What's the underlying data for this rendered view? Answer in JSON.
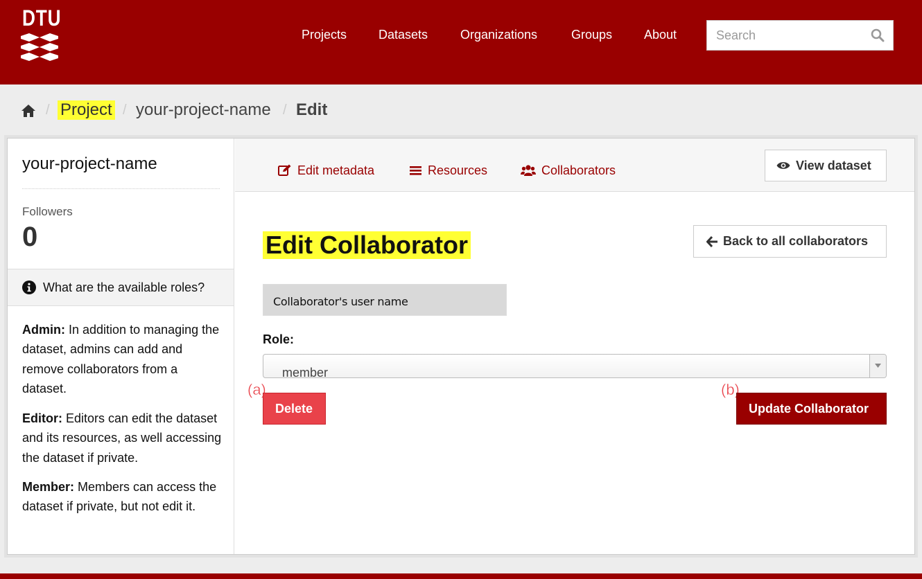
{
  "brand": {
    "logo_text": "DTU"
  },
  "nav": {
    "items": [
      {
        "label": "Projects"
      },
      {
        "label": "Datasets"
      },
      {
        "label": "Organizations"
      },
      {
        "label": "Groups"
      },
      {
        "label": "About"
      }
    ],
    "search_placeholder": "Search"
  },
  "breadcrumb": {
    "home_icon": "home-icon",
    "items": [
      "Project",
      "your-project-name",
      "Edit"
    ],
    "separator": "/"
  },
  "sidebar": {
    "title": "your-project-name",
    "followers_label": "Followers",
    "followers_count": "0",
    "roles_header": "What are the available roles?",
    "roles": [
      {
        "name": "Admin:",
        "text": " In addition to managing the dataset, admins can add and remove collaborators from a dataset."
      },
      {
        "name": "Editor:",
        "text": " Editors can edit the dataset and its resources, as well accessing the dataset if private."
      },
      {
        "name": "Member:",
        "text": " Members can access the dataset if private, but not edit it."
      }
    ]
  },
  "tabs": [
    {
      "label": "Edit metadata",
      "icon": "edit-icon"
    },
    {
      "label": "Resources",
      "icon": "list-icon"
    },
    {
      "label": "Collaborators",
      "icon": "users-icon"
    }
  ],
  "view_dataset_label": "View dataset",
  "form": {
    "heading": "Edit Collaborator",
    "back_label": "Back to all collaborators",
    "username_value": "Collaborator's user name",
    "role_label": "Role:",
    "role_value": "member",
    "delete_label": "Delete",
    "update_label": "Update Collaborator"
  },
  "annotations": {
    "a": "(a)",
    "b": "(b)"
  },
  "colors": {
    "brand": "#990000",
    "danger": "#e9424a",
    "highlight": "#ffff33"
  }
}
